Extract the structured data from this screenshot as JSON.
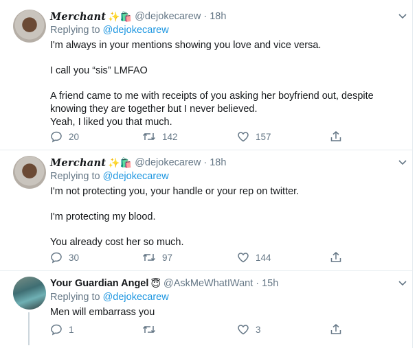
{
  "tweets": [
    {
      "name": "Merchant",
      "emoji": "✨🛍️",
      "handle": "@dejokecarew",
      "time": "18h",
      "replying_label": "Replying to",
      "replying_to": "@dejokecarew",
      "paragraphs": [
        [
          "I'm always in your mentions showing you love and vice versa."
        ],
        [
          "I call you “sis” LMFAO"
        ],
        [
          "A friend came to me with receipts of you asking her boyfriend out, despite knowing they are together but I never believed.",
          "Yeah, I liked you that much."
        ]
      ],
      "replies": "20",
      "retweets": "142",
      "likes": "157"
    },
    {
      "name": "Merchant",
      "emoji": "✨🛍️",
      "handle": "@dejokecarew",
      "time": "18h",
      "replying_label": "Replying to",
      "replying_to": "@dejokecarew",
      "paragraphs": [
        [
          "I'm not protecting you, your handle or your rep on twitter."
        ],
        [
          "I'm protecting my blood."
        ],
        [
          "You already cost her so much."
        ]
      ],
      "replies": "30",
      "retweets": "97",
      "likes": "144"
    },
    {
      "name": "Your Guardian Angel",
      "emoji": "😇",
      "handle": "@AskMeWhatIWant",
      "time": "15h",
      "replying_label": "Replying to",
      "replying_to": "@dejokecarew",
      "paragraphs": [
        [
          "Men will embarrass you"
        ]
      ],
      "replies": "1",
      "retweets": "",
      "likes": "3"
    }
  ],
  "separator": "·",
  "icons": {
    "reply": "reply-icon",
    "retweet": "retweet-icon",
    "like": "heart-icon",
    "share": "share-icon",
    "caret": "chevron-down-icon"
  },
  "colors": {
    "link": "#1b95e0",
    "secondary": "#657786",
    "border": "#e6ecf0"
  }
}
